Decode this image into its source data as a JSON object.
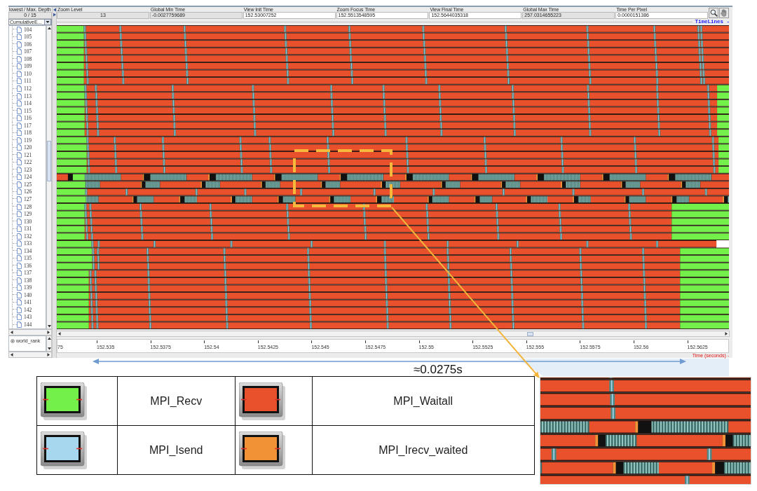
{
  "toolbar": {
    "depth": {
      "label": "lowest / Max. Depth",
      "value": "0 / 15"
    },
    "fields": [
      {
        "label": "Zoom Level",
        "value": "13",
        "editable": false
      },
      {
        "label": "Global Min Time",
        "value": "-0.0027759689",
        "editable": false
      },
      {
        "label": "View Init Time",
        "value": "152.53007252",
        "editable": true
      },
      {
        "label": "Zoom Focus Time",
        "value": "152.5513548595",
        "editable": true
      },
      {
        "label": "View Final Time",
        "value": "152.5644035318",
        "editable": true
      },
      {
        "label": "Global Max Time",
        "value": "257.0314655223",
        "editable": false
      },
      {
        "label": "Time Per Pixel",
        "value": "0.0000151386",
        "editable": true
      }
    ]
  },
  "tree": {
    "dropdown": "CumulativeE...",
    "items": [
      "104",
      "105",
      "106",
      "107",
      "108",
      "109",
      "110",
      "111",
      "112",
      "113",
      "114",
      "115",
      "116",
      "117",
      "118",
      "119",
      "120",
      "121",
      "122",
      "123",
      "124",
      "125",
      "126",
      "127",
      "128",
      "129",
      "130",
      "131",
      "132",
      "133",
      "134",
      "135",
      "136",
      "137",
      "138",
      "139",
      "140",
      "141",
      "142",
      "143",
      "144"
    ],
    "root": "world_rank"
  },
  "timeline": {
    "title": "TimeLines -"
  },
  "axis": {
    "ticks": [
      "75",
      "152.535",
      "152.5375",
      "152.54",
      "152.5425",
      "152.545",
      "152.5475",
      "152.55",
      "152.5525",
      "152.555",
      "152.5575",
      "152.56",
      "152.5625"
    ],
    "unit_label": "Time (seconds) -"
  },
  "span": {
    "label": "≈0.0275s"
  },
  "legend": [
    {
      "name": "MPI_Recv",
      "color": "#74f04a"
    },
    {
      "name": "MPI_Waitall",
      "color": "#e9502c"
    },
    {
      "name": "MPI_Isend",
      "color": "#a6d7ee"
    },
    {
      "name": "MPI_Irecv_waited",
      "color": "#f29236"
    }
  ]
}
